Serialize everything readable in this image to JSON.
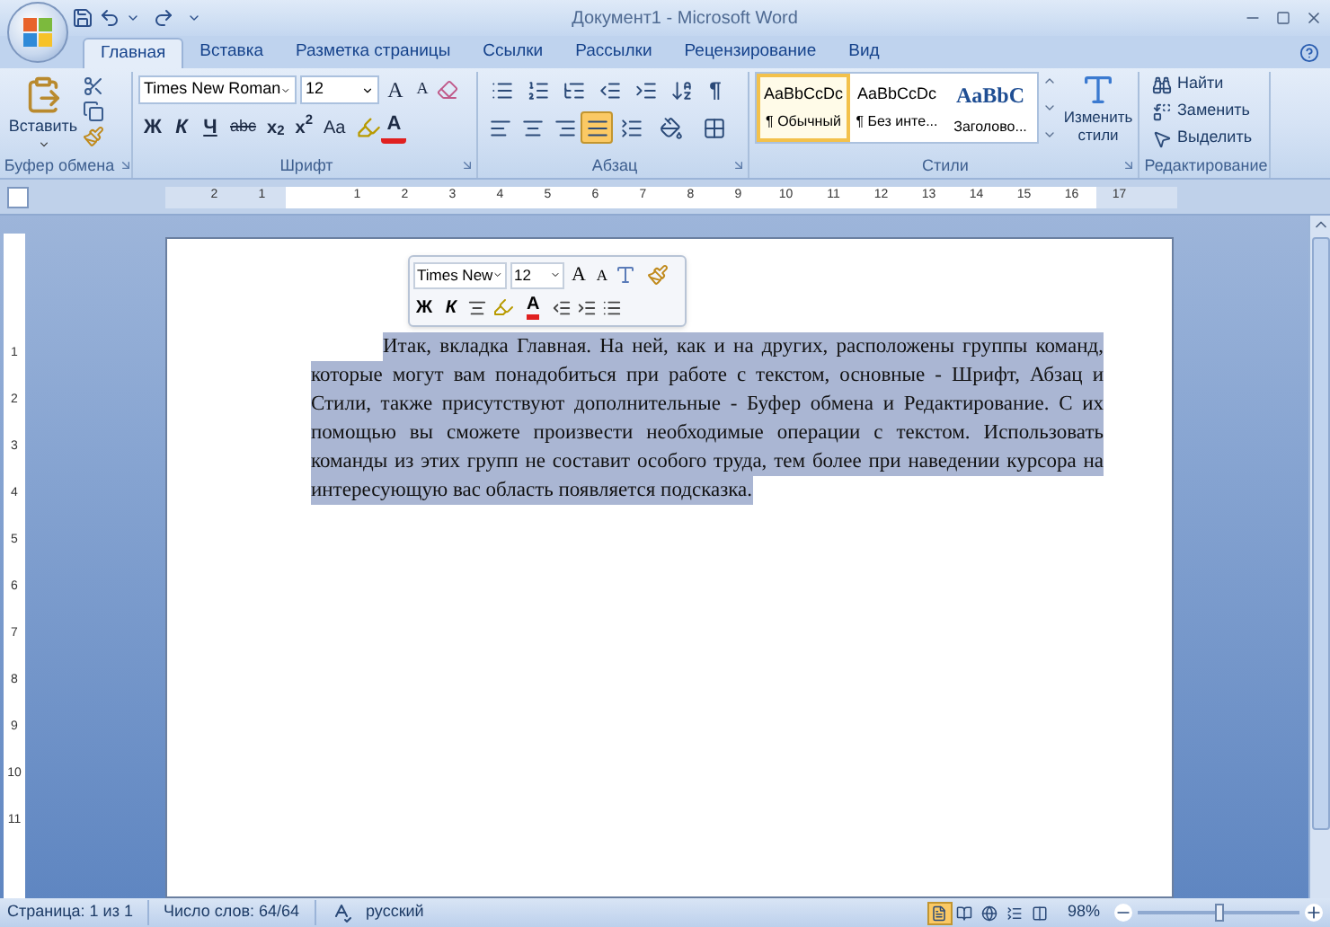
{
  "window": {
    "title": "Документ1 - Microsoft Word"
  },
  "tabs": [
    {
      "label": "Главная",
      "selected": true
    },
    {
      "label": "Вставка",
      "selected": false
    },
    {
      "label": "Разметка страницы",
      "selected": false
    },
    {
      "label": "Ссылки",
      "selected": false
    },
    {
      "label": "Рассылки",
      "selected": false
    },
    {
      "label": "Рецензирование",
      "selected": false
    },
    {
      "label": "Вид",
      "selected": false
    }
  ],
  "clipboard": {
    "label": "Буфер обмена",
    "paste": "Вставить"
  },
  "font": {
    "label": "Шрифт",
    "font_name": "Times New Roman",
    "font_size": "12",
    "grow": "A",
    "shrink": "A",
    "format_buttons": [
      {
        "kind": "bold",
        "label": "Ж"
      },
      {
        "kind": "italic",
        "label": "К"
      },
      {
        "kind": "underline",
        "label": "Ч"
      },
      {
        "kind": "strike",
        "label": "abc"
      },
      {
        "kind": "subscript",
        "label": "x$_{2}$"
      },
      {
        "kind": "superscript",
        "label": "x$^{2}$"
      },
      {
        "kind": "case",
        "label": "Aa"
      },
      {
        "kind": "highlight"
      },
      {
        "kind": "font_color",
        "label": "A"
      }
    ]
  },
  "paragraph": {
    "label": "Абзац",
    "pilcrow": "¶",
    "alignment": [
      {
        "kind": "left",
        "selected": false
      },
      {
        "kind": "center",
        "selected": false
      },
      {
        "kind": "right",
        "selected": false
      },
      {
        "kind": "justify",
        "selected": true
      }
    ]
  },
  "styles": {
    "label": "Стили",
    "change": "Изменить стили",
    "items": [
      {
        "kind": "body",
        "preview": "AaBbCcDc",
        "name": "¶ Обычный",
        "selected": true
      },
      {
        "kind": "body",
        "preview": "AaBbCcDc",
        "name": "¶ Без инте...",
        "selected": false
      },
      {
        "kind": "heading",
        "preview": "AaBbC",
        "name": "Заголово...",
        "selected": false
      }
    ]
  },
  "editing": {
    "label": "Редактирование",
    "items": [
      {
        "kind": "find",
        "label": "Найти"
      },
      {
        "kind": "replace",
        "label": "Заменить"
      },
      {
        "kind": "select",
        "label": "Выделить"
      }
    ]
  },
  "ruler": {
    "left_labels": [
      "2",
      "1"
    ],
    "right_labels": [
      "1",
      "2",
      "3",
      "4",
      "5",
      "6",
      "7",
      "8",
      "9",
      "10",
      "11",
      "12",
      "13",
      "14",
      "15",
      "16",
      "17"
    ]
  },
  "vertical_ruler": [
    "1",
    "2",
    "3",
    "4",
    "5",
    "6",
    "7",
    "8",
    "9",
    "10",
    "11"
  ],
  "mini_toolbar": {
    "font_name": "Times New",
    "font_size": "12",
    "grow": "A",
    "shrink": "A",
    "bold": "Ж",
    "italic": "К",
    "font_color": "A"
  },
  "document": {
    "text": "Итак, вкладка Главная. На ней, как и на других, расположены группы команд, которые могут вам понадобиться при работе с текстом, основные - Шрифт, Абзац и Стили, также присутствуют дополнительные - Буфер обмена и Редактирование. С их помощью вы сможете произвести необходимые операции с текстом. Использовать команды из этих групп не составит особого труда, тем более при наведении курсора на интересующую вас область появляется подсказка.",
    "selected": true
  },
  "status_bar": {
    "page": "Страница: 1 из 1",
    "words": "Число слов: 64/64",
    "language": "русский",
    "views": [
      {
        "kind": "print",
        "selected": true
      },
      {
        "kind": "reading",
        "selected": false
      },
      {
        "kind": "web",
        "selected": false
      },
      {
        "kind": "outline",
        "selected": false
      },
      {
        "kind": "draft",
        "selected": false
      }
    ],
    "zoom": "98%",
    "zoom_slider": {
      "level": 0.5
    }
  }
}
